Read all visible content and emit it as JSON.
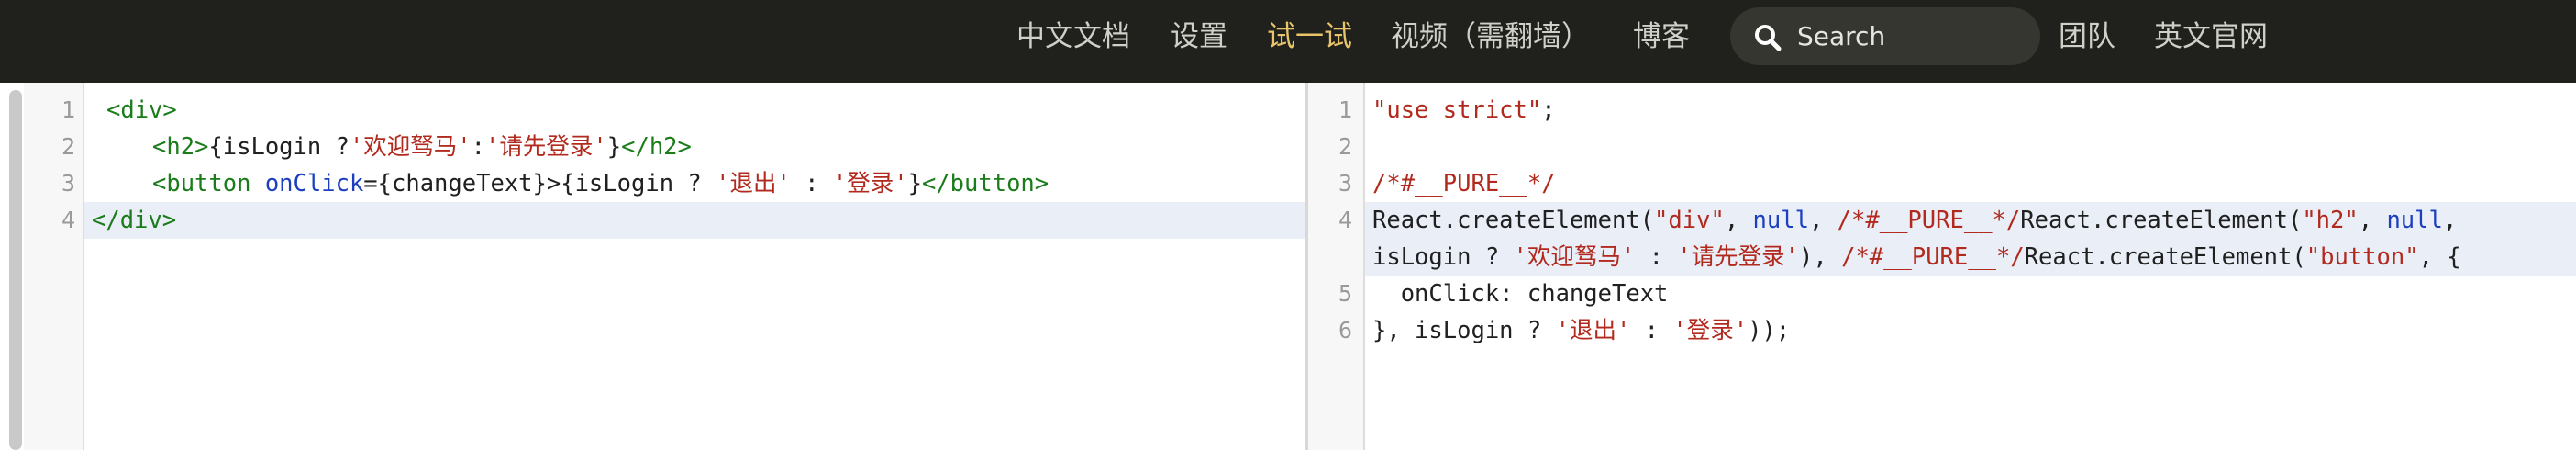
{
  "nav": {
    "items": [
      "中文文档",
      "设置",
      "试一试",
      "视频（需翻墙）",
      "博客",
      "团队",
      "英文官网"
    ],
    "active_index": 2,
    "search_placeholder": "Search"
  },
  "left_editor": {
    "line_numbers": [
      "1",
      "2",
      "3",
      "4"
    ],
    "lines": [
      [
        {
          "t": "t",
          "v": "<div>"
        }
      ],
      [
        {
          "t": "t",
          "v": "<h2>"
        },
        {
          "t": "p",
          "v": "{isLogin ?"
        },
        {
          "t": "s",
          "v": "'欢迎驽马'"
        },
        {
          "t": "p",
          "v": ":"
        },
        {
          "t": "s",
          "v": "'请先登录'"
        },
        {
          "t": "p",
          "v": "}"
        },
        {
          "t": "t",
          "v": "</h2>"
        }
      ],
      [
        {
          "t": "t",
          "v": "<button "
        },
        {
          "t": "a",
          "v": "onClick"
        },
        {
          "t": "p",
          "v": "={changeText}>{isLogin ? "
        },
        {
          "t": "s",
          "v": "'退出'"
        },
        {
          "t": "p",
          "v": " : "
        },
        {
          "t": "s",
          "v": "'登录'"
        },
        {
          "t": "p",
          "v": "}"
        },
        {
          "t": "t",
          "v": "</button>"
        }
      ],
      [
        {
          "t": "t",
          "v": "</div>"
        }
      ]
    ]
  },
  "right_editor": {
    "line_numbers": [
      "1",
      "2",
      "3",
      "4",
      "",
      "5",
      "6"
    ],
    "lines": [
      [
        {
          "t": "s",
          "v": "\"use strict\""
        },
        {
          "t": "p",
          "v": ";"
        }
      ],
      [],
      [
        {
          "t": "c",
          "v": "/*#__PURE__*/"
        }
      ],
      [
        {
          "t": "p",
          "v": "React.createElement("
        },
        {
          "t": "s",
          "v": "\"div\""
        },
        {
          "t": "p",
          "v": ", "
        },
        {
          "t": "k",
          "v": "null"
        },
        {
          "t": "p",
          "v": ", "
        },
        {
          "t": "c",
          "v": "/*#__PURE__*/"
        },
        {
          "t": "p",
          "v": "React.createElement("
        },
        {
          "t": "s",
          "v": "\"h2\""
        },
        {
          "t": "p",
          "v": ", "
        },
        {
          "t": "k",
          "v": "null"
        },
        {
          "t": "p",
          "v": ","
        }
      ],
      [
        {
          "t": "p",
          "v": "isLogin ? "
        },
        {
          "t": "s",
          "v": "'欢迎驽马'"
        },
        {
          "t": "p",
          "v": " : "
        },
        {
          "t": "s",
          "v": "'请先登录'"
        },
        {
          "t": "p",
          "v": "), "
        },
        {
          "t": "c",
          "v": "/*#__PURE__*/"
        },
        {
          "t": "p",
          "v": "React.createElement("
        },
        {
          "t": "s",
          "v": "\"button\""
        },
        {
          "t": "p",
          "v": ", {"
        }
      ],
      [
        {
          "t": "p",
          "v": "  onClick: changeText"
        }
      ],
      [
        {
          "t": "p",
          "v": "}, isLogin ? "
        },
        {
          "t": "s",
          "v": "'退出'"
        },
        {
          "t": "p",
          "v": " : "
        },
        {
          "t": "s",
          "v": "'登录'"
        },
        {
          "t": "p",
          "v": "));"
        }
      ]
    ]
  }
}
